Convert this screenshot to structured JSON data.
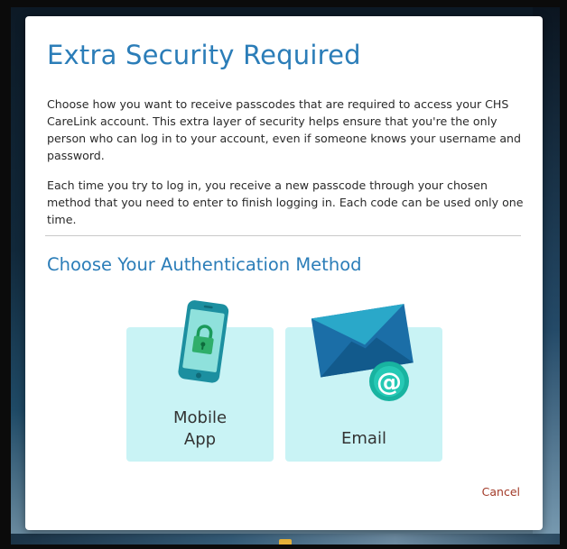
{
  "dialog": {
    "title": "Extra Security Required",
    "paragraph_1": "Choose how you want to receive passcodes that are required to access your CHS CareLink account. This extra layer of security helps ensure that you're the only person who can log in to your account, even if someone knows your username and password.",
    "paragraph_2": "Each time you try to log in, you receive a new passcode through your chosen method that you need to enter to finish logging in. Each code can be used only one time.",
    "subtitle": "Choose Your Authentication Method",
    "options": {
      "mobile": {
        "label_line_1": "Mobile",
        "label_line_2": "App",
        "icon": "mobile-phone-lock-icon"
      },
      "email": {
        "label": "Email",
        "icon": "envelope-at-icon"
      }
    },
    "cancel_label": "Cancel"
  },
  "colors": {
    "title": "#2b7db8",
    "option_tile": "#c9f3f5",
    "cancel": "#a23a28",
    "icon_teal": "#26b7a7",
    "envelope_blue": "#1f6fa8"
  }
}
